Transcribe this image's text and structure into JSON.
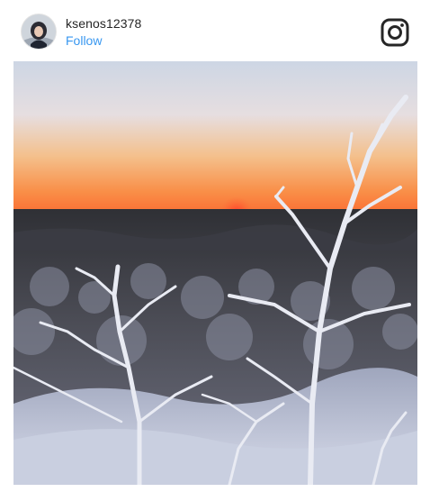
{
  "post": {
    "username": "ksenos12378",
    "follow_label": "Follow",
    "profile_icon": "avatar",
    "brand_icon": "instagram-icon",
    "photo_subject": "winter-sunset-photo"
  },
  "colors": {
    "follow_blue": "#3897f0",
    "username_text": "#262626",
    "sun": "#ff3b2a"
  }
}
